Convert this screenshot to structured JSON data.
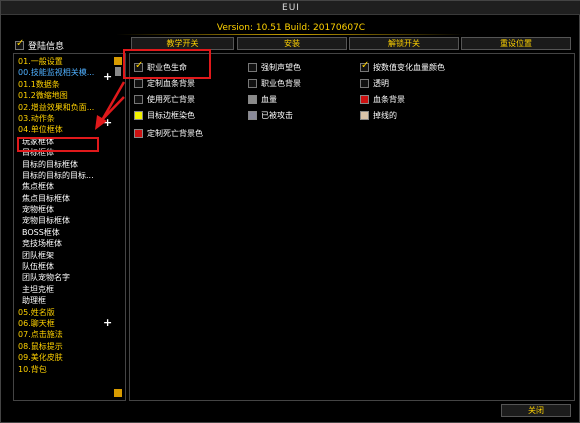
{
  "window": {
    "title": "EUI"
  },
  "version": "Version: 10.51 Build: 20170607C",
  "left": {
    "header_label": "登陆信息",
    "header_checked": true,
    "items": [
      {
        "label": "01.一般设置",
        "kind": "top"
      },
      {
        "label": "00.技能监视相关模...",
        "kind": "cur"
      },
      {
        "label": "01.1数据条",
        "kind": "top"
      },
      {
        "label": "01.2微缩地图",
        "kind": "top"
      },
      {
        "label": "02.增益效果和负面...",
        "kind": "top"
      },
      {
        "label": "03.动作条",
        "kind": "top"
      },
      {
        "label": "04.单位框体",
        "kind": "top"
      },
      {
        "label": "玩家框体",
        "kind": "sub"
      },
      {
        "label": "目标框体",
        "kind": "sub"
      },
      {
        "label": "目标的目标框体",
        "kind": "sub"
      },
      {
        "label": "目标的目标的目标...",
        "kind": "sub"
      },
      {
        "label": "焦点框体",
        "kind": "sub"
      },
      {
        "label": "焦点目标框体",
        "kind": "sub"
      },
      {
        "label": "宠物框体",
        "kind": "sub"
      },
      {
        "label": "宠物目标框体",
        "kind": "sub"
      },
      {
        "label": "BOSS框体",
        "kind": "sub"
      },
      {
        "label": "竞技场框体",
        "kind": "sub"
      },
      {
        "label": "团队框架",
        "kind": "sub"
      },
      {
        "label": "队伍框体",
        "kind": "sub"
      },
      {
        "label": "团队宠物名字",
        "kind": "sub"
      },
      {
        "label": "主坦克框",
        "kind": "sub"
      },
      {
        "label": "助理框",
        "kind": "sub"
      },
      {
        "label": "05.姓名版",
        "kind": "top"
      },
      {
        "label": "06.聊天框",
        "kind": "top"
      },
      {
        "label": "07.点击施法",
        "kind": "top"
      },
      {
        "label": "08.鼠标提示",
        "kind": "top"
      },
      {
        "label": "09.美化皮肤",
        "kind": "top"
      },
      {
        "label": "10.背包",
        "kind": "top"
      }
    ]
  },
  "tabs": [
    "教学开关",
    "安装",
    "解锁开关",
    "重设位置"
  ],
  "options": [
    {
      "label": "职业色生命",
      "checked": true
    },
    {
      "label": "强制声望色",
      "checked": false
    },
    {
      "label": "按数值变化血量颜色",
      "checked": true
    },
    {
      "label": "定制血条背景",
      "checked": false
    },
    {
      "label": "职业色背景",
      "checked": false
    },
    {
      "label": "透明",
      "checked": false
    },
    {
      "label": "使用死亡背景",
      "checked": false
    },
    {
      "label": "血量",
      "swatch": "#8a8a8a"
    },
    {
      "label": "血条背景",
      "swatch": "#cc1111"
    },
    {
      "label": "目标边框染色",
      "swatch": "#f2f200"
    },
    {
      "label": "已被攻击",
      "swatch": "#8a8a99"
    },
    {
      "label": "掉线的",
      "swatch": "#d9c4aa"
    },
    {
      "label": "定制死亡背景色",
      "swatch": "#cc1111"
    }
  ],
  "close_label": "关闭",
  "colors": {
    "accent": "#ffd200",
    "annotation": "#e0191b",
    "link": "#4fb0ff"
  }
}
